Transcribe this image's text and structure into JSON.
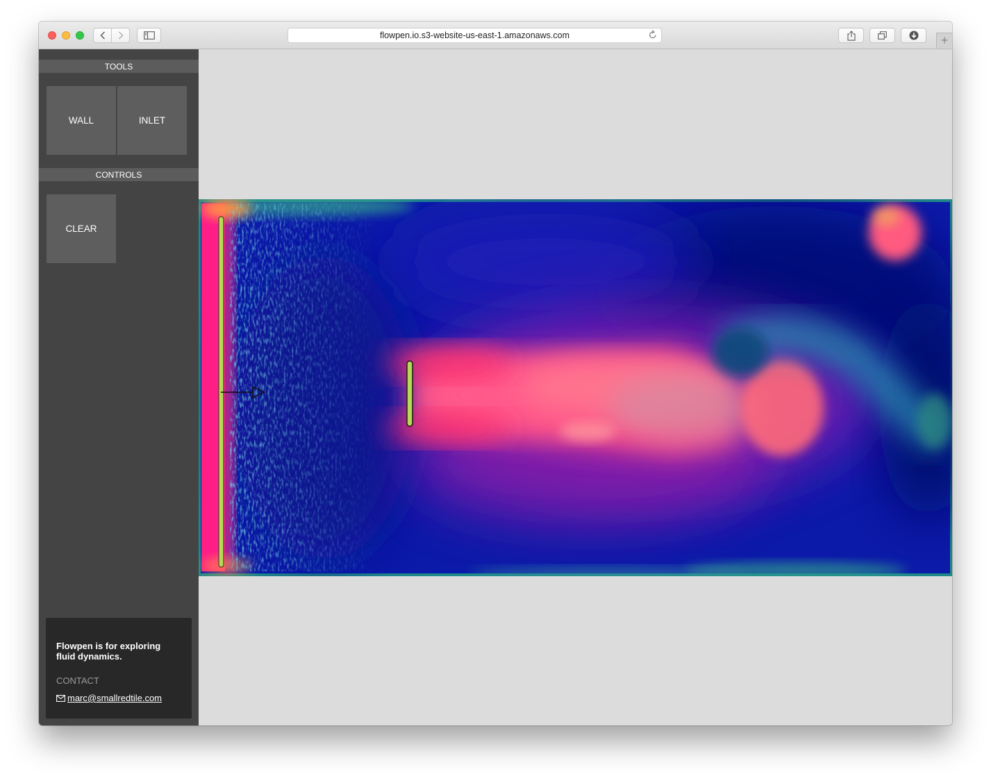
{
  "browser": {
    "url": "flowpen.io.s3-website-us-east-1.amazonaws.com"
  },
  "sidebar": {
    "tools_header": "TOOLS",
    "tools": [
      {
        "label": "WALL"
      },
      {
        "label": "INLET"
      }
    ],
    "controls_header": "CONTROLS",
    "controls": [
      {
        "label": "CLEAR"
      }
    ],
    "info": {
      "description": "Flowpen is for exploring fluid dynamics.",
      "contact_label": "CONTACT",
      "email": "marc@smallredtile.com"
    }
  },
  "colors": {
    "sidebar_bg": "#444444",
    "button_bg": "#5e5e5e",
    "wall_color": "#b8d85a",
    "flow_base": "#0b1aa8",
    "flow_hot": "#ff3f7a",
    "frame_teal": "#1f8a8a"
  },
  "icons": [
    "back-icon",
    "forward-icon",
    "sidebar-icon",
    "reload-icon",
    "share-icon",
    "tabs-icon",
    "download-icon",
    "plus-icon",
    "mail-icon",
    "inlet-arrow-icon"
  ]
}
